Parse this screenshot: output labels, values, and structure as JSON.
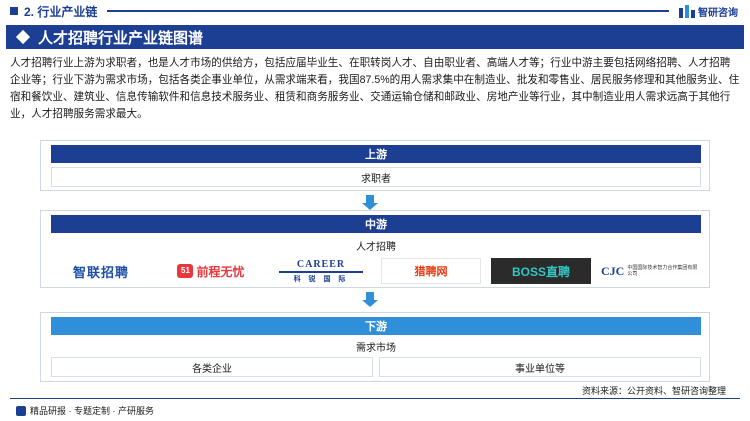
{
  "header": {
    "section": "2. 行业产业链",
    "logo_text": "智研咨询",
    "title": "人才招聘行业产业链图谱"
  },
  "intro": "人才招聘行业上游为求职者，也是人才市场的供给方，包括应届毕业生、在职转岗人才、自由职业者、高端人才等；行业中游主要包括网络招聘、人才招聘企业等；行业下游为需求市场，包括各类企事业单位，从需求端来看，我国87.5%的用人需求集中在制造业、批发和零售业、居民服务修理和其他服务业、住宿和餐饮业、建筑业、信息传输软件和信息技术服务业、租赁和商务服务业、交通运输仓储和邮政业、房地产业等行业，其中制造业用人需求远高于其他行业，人才招聘服务需求最大。",
  "upstream": {
    "header": "上游",
    "item": "求职者"
  },
  "midstream": {
    "header": "中游",
    "subtitle": "人才招聘",
    "logos": {
      "zhilian": "智联招聘",
      "job51": "前程无忧",
      "job51_badge": "51",
      "career_en": "CAREER",
      "career_en2": "INTERNATIONAL",
      "career_cn": "科 锐 国 际",
      "liepin": "猎聘网",
      "boss": "BOSS直聘",
      "cjc_mark": "CJC",
      "cjc_name": "中国国际技术智力合作集团有限公司"
    }
  },
  "downstream": {
    "header": "下游",
    "subtitle": "需求市场",
    "items": [
      "各类企业",
      "事业单位等"
    ]
  },
  "footer": {
    "left": "精品研报 · 专题定制 · 产研服务",
    "source": "资料来源：公开资料、智研咨询整理"
  },
  "colors": {
    "primary": "#1c3f94",
    "accent": "#2f8fd8"
  }
}
